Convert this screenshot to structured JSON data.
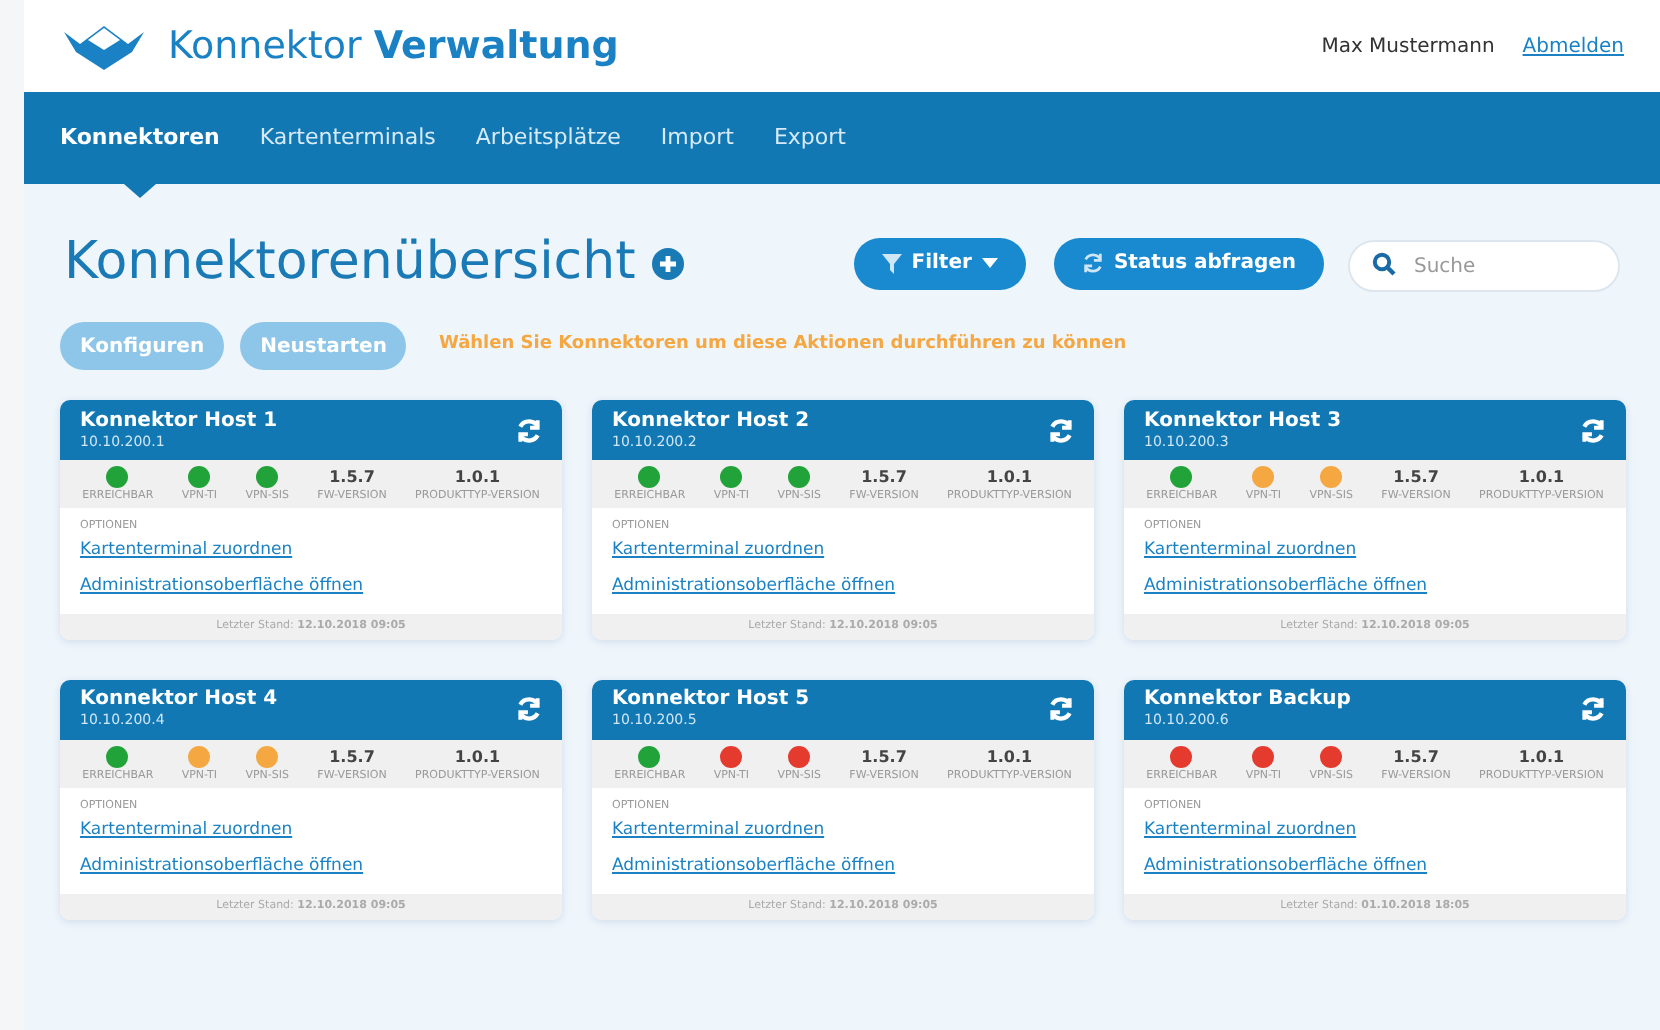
{
  "header": {
    "brand_light": "Konnektor",
    "brand_bold": "Verwaltung",
    "user": "Max Mustermann",
    "logout": "Abmelden"
  },
  "nav": [
    {
      "label": "Konnektoren",
      "selected": true
    },
    {
      "label": "Kartenterminals",
      "selected": false
    },
    {
      "label": "Arbeitsplätze",
      "selected": false
    },
    {
      "label": "Import",
      "selected": false
    },
    {
      "label": "Export",
      "selected": false
    }
  ],
  "page_title": "Konnektorenübersicht",
  "filter_button": "Filter",
  "status_button": "Status abfragen",
  "search": {
    "placeholder": "Suche"
  },
  "actions": [
    {
      "label": "Konfiguren",
      "disabled": true
    },
    {
      "label": "Neustarten",
      "disabled": true
    }
  ],
  "hint": "Wählen Sie Konnektoren um diese Aktionen durchführen zu können",
  "connectors": [
    {
      "name": "Konnektor Host 1",
      "ip": "10.10.200.1",
      "indicators": [
        {
          "label": "ERREICHBAR",
          "color": "#22a33a"
        },
        {
          "label": "VPN-TI",
          "color": "#22a33a"
        },
        {
          "label": "VPN-SIS",
          "color": "#22a33a"
        }
      ],
      "fw_version": "1.5.7",
      "fw_label": "FW-VERSION",
      "product_version": "1.0.1",
      "product_label": "PRODUKTTYP-VERSION",
      "options_label": "OPTIONEN",
      "links": [
        "Kartenterminal zuordnen",
        "Administrationsoberfläche öffnen"
      ],
      "footer": "Letzter Stand: **12.10.2018 09:05**"
    },
    {
      "name": "Konnektor Host 2",
      "ip": "10.10.200.2",
      "indicators": [
        {
          "label": "ERREICHBAR",
          "color": "#22a33a"
        },
        {
          "label": "VPN-TI",
          "color": "#22a33a"
        },
        {
          "label": "VPN-SIS",
          "color": "#22a33a"
        }
      ],
      "fw_version": "1.5.7",
      "fw_label": "FW-VERSION",
      "product_version": "1.0.1",
      "product_label": "PRODUKTTYP-VERSION",
      "options_label": "OPTIONEN",
      "links": [
        "Kartenterminal zuordnen",
        "Administrationsoberfläche öffnen"
      ],
      "footer": "Letzter Stand: **12.10.2018 09:05**"
    },
    {
      "name": "Konnektor Host 3",
      "ip": "10.10.200.3",
      "indicators": [
        {
          "label": "ERREICHBAR",
          "color": "#22a33a"
        },
        {
          "label": "VPN-TI",
          "color": "#f5a742"
        },
        {
          "label": "VPN-SIS",
          "color": "#f5a742"
        }
      ],
      "fw_version": "1.5.7",
      "fw_label": "FW-VERSION",
      "product_version": "1.0.1",
      "product_label": "PRODUKTTYP-VERSION",
      "options_label": "OPTIONEN",
      "links": [
        "Kartenterminal zuordnen",
        "Administrationsoberfläche öffnen"
      ],
      "footer": "Letzter Stand: **12.10.2018 09:05**"
    },
    {
      "name": "Konnektor Host 4",
      "ip": "10.10.200.4",
      "indicators": [
        {
          "label": "ERREICHBAR",
          "color": "#22a33a"
        },
        {
          "label": "VPN-TI",
          "color": "#f5a742"
        },
        {
          "label": "VPN-SIS",
          "color": "#f5a742"
        }
      ],
      "fw_version": "1.5.7",
      "fw_label": "FW-VERSION",
      "product_version": "1.0.1",
      "product_label": "PRODUKTTYP-VERSION",
      "options_label": "OPTIONEN",
      "links": [
        "Kartenterminal zuordnen",
        "Administrationsoberfläche öffnen"
      ],
      "footer": "Letzter Stand: **12.10.2018 09:05**"
    },
    {
      "name": "Konnektor Host 5",
      "ip": "10.10.200.5",
      "indicators": [
        {
          "label": "ERREICHBAR",
          "color": "#22a33a"
        },
        {
          "label": "VPN-TI",
          "color": "#e53a2e"
        },
        {
          "label": "VPN-SIS",
          "color": "#e53a2e"
        }
      ],
      "fw_version": "1.5.7",
      "fw_label": "FW-VERSION",
      "product_version": "1.0.1",
      "product_label": "PRODUKTTYP-VERSION",
      "options_label": "OPTIONEN",
      "links": [
        "Kartenterminal zuordnen",
        "Administrationsoberfläche öffnen"
      ],
      "footer": "Letzter Stand: **12.10.2018 09:05**"
    },
    {
      "name": "Konnektor Backup",
      "ip": "10.10.200.6",
      "indicators": [
        {
          "label": "ERREICHBAR",
          "color": "#e53a2e"
        },
        {
          "label": "VPN-TI",
          "color": "#e53a2e"
        },
        {
          "label": "VPN-SIS",
          "color": "#e53a2e"
        }
      ],
      "fw_version": "1.5.7",
      "fw_label": "FW-VERSION",
      "product_version": "1.0.1",
      "product_label": "PRODUKTTYP-VERSION",
      "options_label": "OPTIONEN",
      "links": [
        "Kartenterminal zuordnen",
        "Administrationsoberfläche öffnen"
      ],
      "footer": "Letzter Stand: **01.10.2018 18:05**"
    }
  ]
}
